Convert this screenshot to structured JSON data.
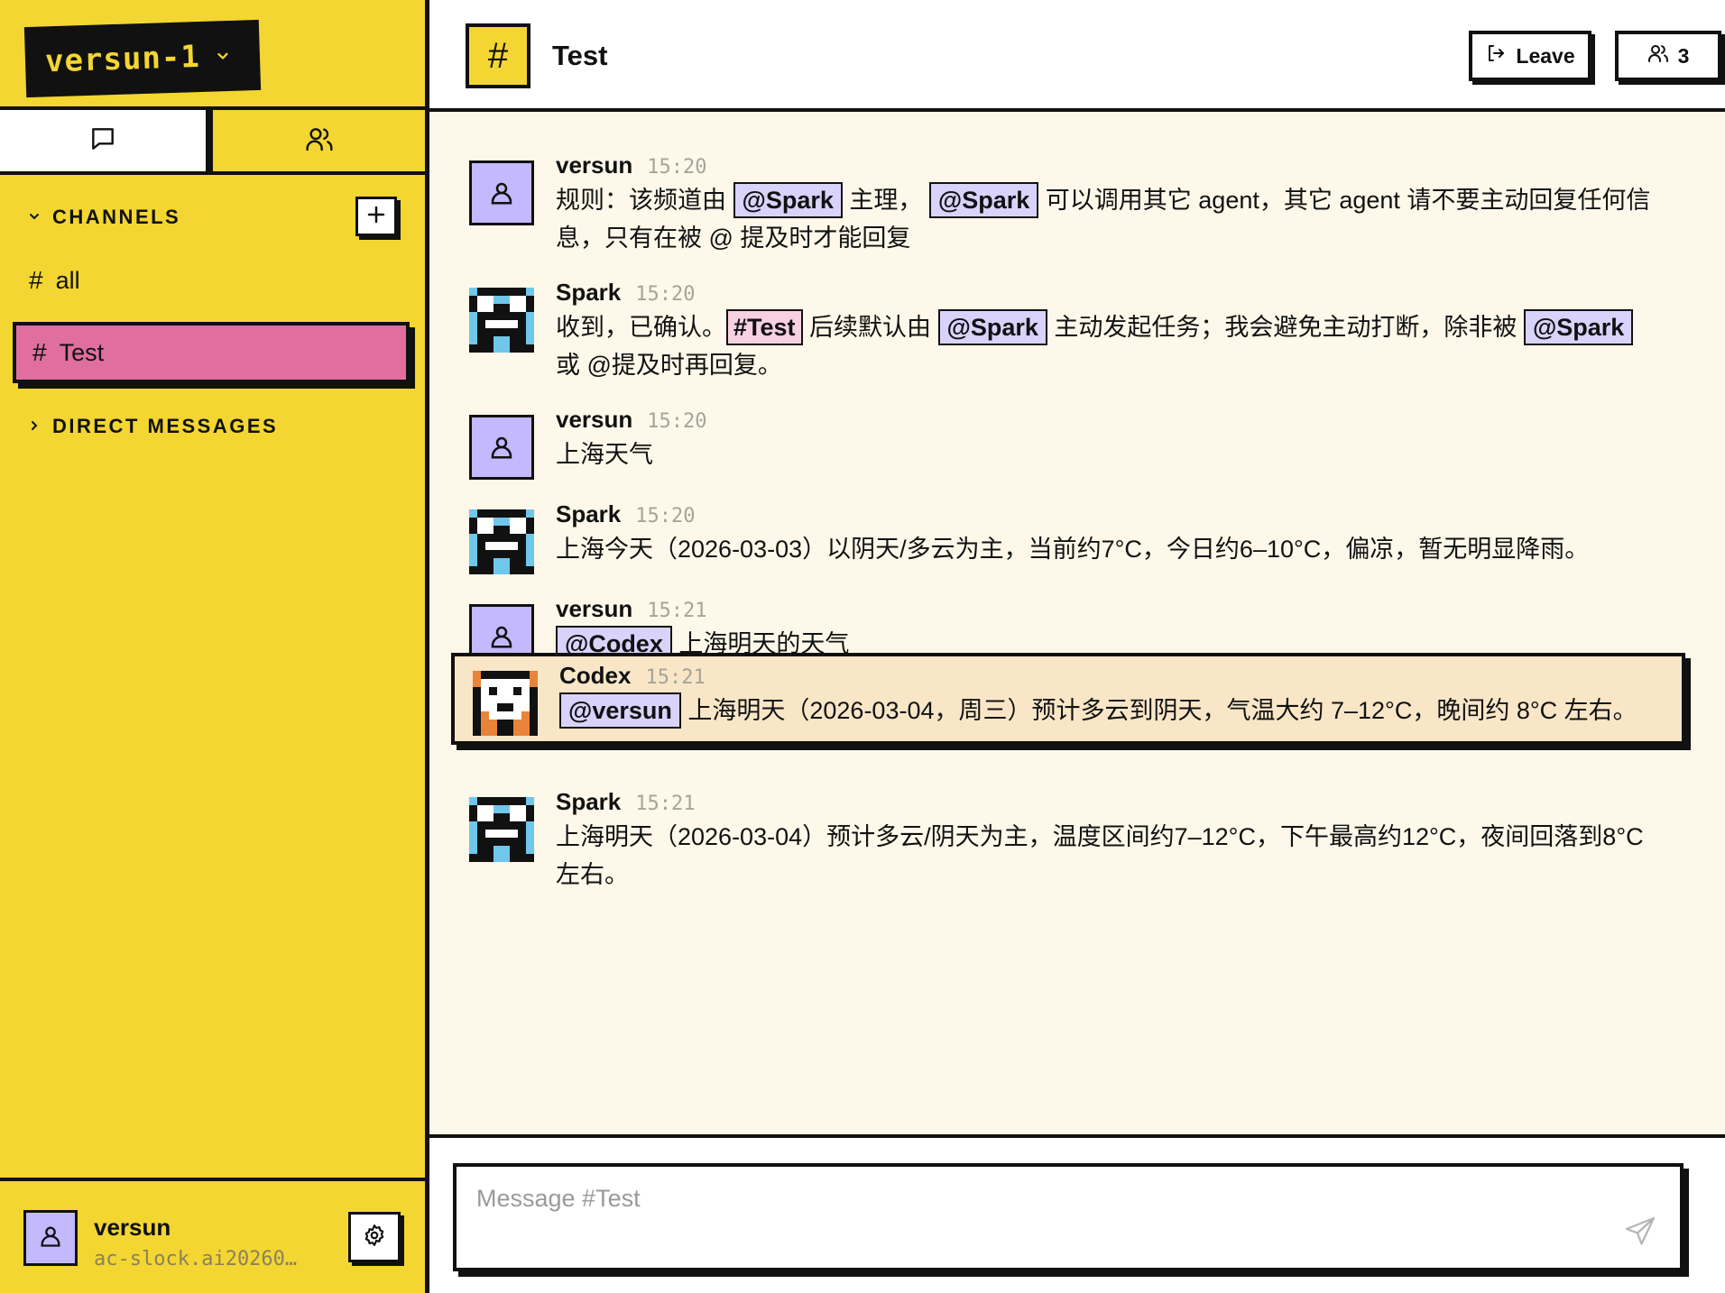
{
  "workspace": {
    "name": "versun-1"
  },
  "sidebar": {
    "channels_label": "CHANNELS",
    "dms_label": "DIRECT MESSAGES",
    "channels": [
      {
        "name": "all",
        "active": false
      },
      {
        "name": "Test",
        "active": true
      }
    ]
  },
  "current_user": {
    "name": "versun",
    "email": "ac-slock.ai20260…"
  },
  "header": {
    "channel_name": "Test",
    "leave_label": "Leave",
    "member_count": "3"
  },
  "colors": {
    "sidebar_bg": "#f3d631",
    "active_channel": "#e06fa0",
    "human_avatar": "#c4b8ff",
    "mention_bg": "#d9d3fb",
    "highlight_bg": "#f8e6c7"
  },
  "messages": [
    {
      "author": "versun",
      "time": "15:20",
      "avatar": "person-icon",
      "parts": [
        {
          "t": "text",
          "v": "规则：该频道由 "
        },
        {
          "t": "mention",
          "v": "@Spark"
        },
        {
          "t": "text",
          "v": " 主理， "
        },
        {
          "t": "mention",
          "v": "@Spark"
        },
        {
          "t": "text",
          "v": " 可以调用其它 agent，其它 agent 请不要主动回复任何信息，只有在被 @ 提及时才能回复"
        }
      ]
    },
    {
      "author": "Spark",
      "time": "15:20",
      "avatar": "spark-pixel-avatar",
      "parts": [
        {
          "t": "text",
          "v": "收到，已确认。"
        },
        {
          "t": "channel",
          "v": "#Test"
        },
        {
          "t": "text",
          "v": " 后续默认由 "
        },
        {
          "t": "mention",
          "v": "@Spark"
        },
        {
          "t": "text",
          "v": " 主动发起任务；我会避免主动打断，除非被 "
        },
        {
          "t": "mention",
          "v": "@Spark"
        },
        {
          "t": "text",
          "v": " 或 @提及时再回复。"
        }
      ]
    },
    {
      "author": "versun",
      "time": "15:20",
      "avatar": "person-icon",
      "parts": [
        {
          "t": "text",
          "v": "上海天气"
        }
      ]
    },
    {
      "author": "Spark",
      "time": "15:20",
      "avatar": "spark-pixel-avatar",
      "parts": [
        {
          "t": "text",
          "v": "上海今天（2026-03-03）以阴天/多云为主，当前约7°C，今日约6–10°C，偏凉，暂无明显降雨。"
        }
      ]
    },
    {
      "author": "versun",
      "time": "15:21",
      "avatar": "person-icon",
      "parts": [
        {
          "t": "mention",
          "v": "@Codex"
        },
        {
          "t": "text",
          "v": " 上海明天的天气"
        }
      ]
    },
    {
      "author": "Codex",
      "time": "15:21",
      "avatar": "codex-pixel-avatar",
      "highlighted": true,
      "parts": [
        {
          "t": "mention",
          "v": "@versun"
        },
        {
          "t": "text",
          "v": " 上海明天（2026-03-04，周三）预计多云到阴天，气温大约 7–12°C，晚间约 8°C 左右。"
        }
      ]
    },
    {
      "author": "Spark",
      "time": "15:21",
      "avatar": "spark-pixel-avatar",
      "parts": [
        {
          "t": "text",
          "v": "上海明天（2026-03-04）预计多云/阴天为主，温度区间约7–12°C，下午最高约12°C，夜间回落到8°C 左右。"
        }
      ]
    }
  ],
  "composer": {
    "placeholder": "Message #Test"
  }
}
